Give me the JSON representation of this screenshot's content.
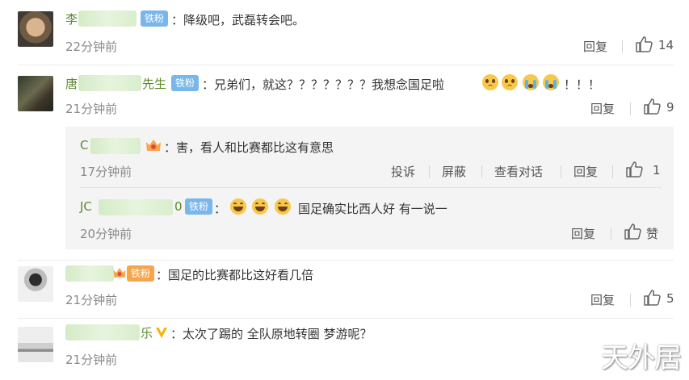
{
  "comments": [
    {
      "name_visible": "李",
      "badge": "铁粉",
      "text": "：降级吧，武磊转会吧。",
      "time": "22分钟前",
      "reply_label": "回复",
      "like_count": "14"
    },
    {
      "name_visible_start": "唐",
      "name_visible_end": "先生",
      "badge": "铁粉",
      "text": "：兄弟们，就这？？？？？？？我想念国足啦",
      "text_suffix": "！！！",
      "time": "21分钟前",
      "reply_label": "回复",
      "like_count": "9",
      "replies": [
        {
          "name_visible": "C",
          "text": "：害，看人和比赛都比这有意思",
          "time": "17分钟前",
          "actions": [
            "投诉",
            "屏蔽",
            "查看对话",
            "回复"
          ],
          "like_count": "1"
        },
        {
          "name_visible_start": "JC",
          "name_visible_end": "0",
          "badge": "铁粉",
          "text_prefix": "：",
          "text": "国足确实比西人好 有一说一",
          "time": "20分钟前",
          "reply_label": "回复",
          "like_label": "赞"
        }
      ]
    },
    {
      "badge": "铁粉",
      "text": "：国足的比赛都比这好看几倍",
      "time": "21分钟前",
      "reply_label": "回复",
      "like_count": "5"
    },
    {
      "name_visible_end": "乐",
      "text": "：太次了踢的 全队原地转圈 梦游呢？",
      "time": "21分钟前"
    }
  ],
  "watermark": "天外居",
  "colors": {
    "name": "#5b8a2e",
    "badge_blue": "#79b6ea",
    "badge_orange": "#f7a54a",
    "verified_gold": "#f5b400"
  }
}
